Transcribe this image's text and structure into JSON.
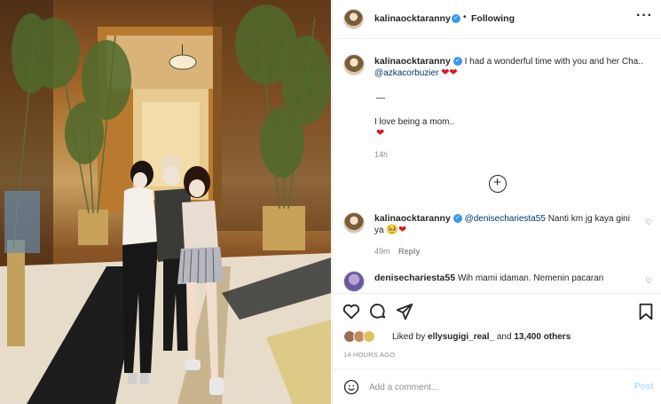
{
  "post": {
    "username": "kalinaocktaranny",
    "follow_status": "Following",
    "more_icon": "more-horizontal-icon"
  },
  "caption": {
    "username": "kalinaocktaranny",
    "line1": "I had a wonderful time with you and her Cha..",
    "mention": "@azkacorbuzier",
    "hearts": "❤❤",
    "dash": "—",
    "line2": "I love being a mom..",
    "heart2": "❤",
    "time": "14h"
  },
  "comments": [
    {
      "username": "kalinaocktaranny",
      "mention": "@denisechariesta55",
      "text_a": "Nanti km jg kaya gini",
      "text_b": "ya",
      "emoji": "🥺❤",
      "time": "49m",
      "reply_label": "Reply"
    },
    {
      "username": "denisechariesta55",
      "text": "Wih mami idaman. Nemenin pacaran"
    }
  ],
  "likes": {
    "prefix": "Liked by",
    "user": "ellysugigi_real_",
    "middle": "and",
    "count": "13,400 others"
  },
  "timestamp": "14 HOURS AGO",
  "comment_box": {
    "placeholder": "Add a comment...",
    "post_label": "Post"
  },
  "colors": {
    "link": "#00376b",
    "verified": "#3897f0",
    "heart": "#e0161e",
    "post_disabled": "#b2dffc"
  }
}
